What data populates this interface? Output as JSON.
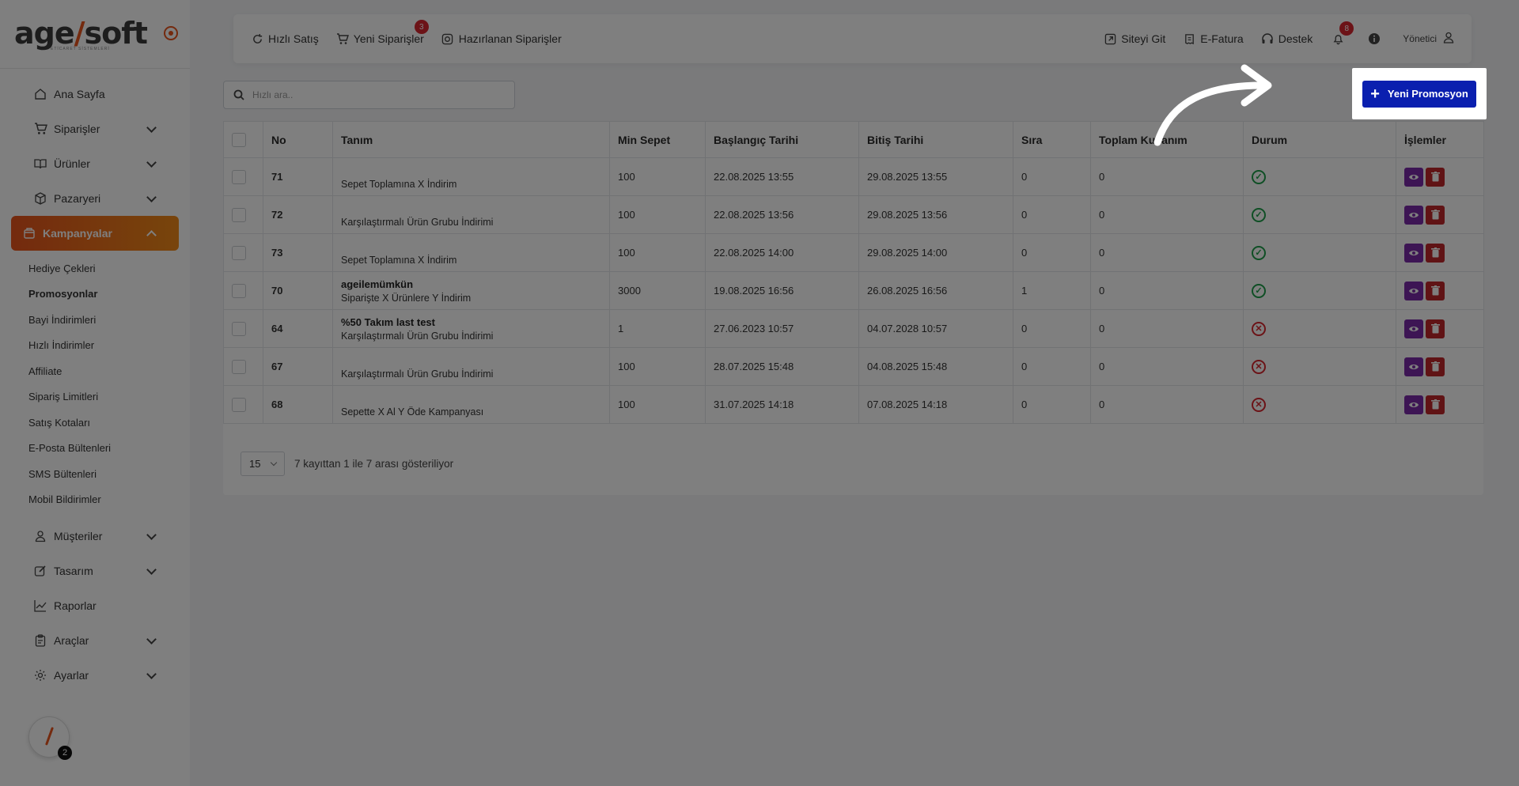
{
  "brand": {
    "logo_main": "age",
    "logo_slash": "/",
    "logo_rest": "soft",
    "logo_sub": "ETİCARET SİSTEMLERİ",
    "accent_color": "#e8541d"
  },
  "sidebar": {
    "items": [
      {
        "label": "Ana Sayfa",
        "icon": "home-icon",
        "has_chevron": false
      },
      {
        "label": "Siparişler",
        "icon": "cart-icon",
        "has_chevron": true
      },
      {
        "label": "Ürünler",
        "icon": "book-icon",
        "has_chevron": true
      },
      {
        "label": "Pazaryeri",
        "icon": "box-icon",
        "has_chevron": true
      },
      {
        "label": "Kampanyalar",
        "icon": "basket-icon",
        "has_chevron": true,
        "active": true
      }
    ],
    "subitems": [
      "Hediye Çekleri",
      "Promosyonlar",
      "Bayi İndirimleri",
      "Hızlı İndirimler",
      "Affiliate",
      "Sipariş Limitleri",
      "Satış Kotaları",
      "E-Posta Bültenleri",
      "SMS Bültenleri",
      "Mobil Bildirimler"
    ],
    "current_sub": "Promosyonlar",
    "bottom_items": [
      {
        "label": "Müşteriler",
        "icon": "user-icon",
        "has_chevron": true
      },
      {
        "label": "Tasarım",
        "icon": "edit-icon",
        "has_chevron": true
      },
      {
        "label": "Raporlar",
        "icon": "chart-icon",
        "has_chevron": false
      },
      {
        "label": "Araçlar",
        "icon": "clipboard-icon",
        "has_chevron": true
      },
      {
        "label": "Ayarlar",
        "icon": "gear-icon",
        "has_chevron": true
      }
    ],
    "helper_count": "2"
  },
  "topbar": {
    "quick_sale": "Hızlı Satış",
    "new_orders": "Yeni Siparişler",
    "new_orders_badge": "3",
    "prepared_orders": "Hazırlanan Siparişler",
    "visit_site": "Siteyi Git",
    "einvoice": "E-Fatura",
    "support": "Destek",
    "notif_badge": "8",
    "user": "Yönetici"
  },
  "search": {
    "placeholder": "Hızlı ara.."
  },
  "actions": {
    "new_promo": "Yeni Promosyon",
    "button_color": "#0a1faf"
  },
  "table": {
    "headers": [
      "No",
      "Tanım",
      "Min Sepet",
      "Başlangıç Tarihi",
      "Bitiş Tarihi",
      "Sıra",
      "Toplam Kullanım",
      "Durum",
      "İşlemler"
    ],
    "rows": [
      {
        "no": "71",
        "name": "",
        "type": "Sepet Toplamına X İndirim",
        "min": "100",
        "start": "22.08.2025 13:55",
        "end": "29.08.2025 13:55",
        "order": "0",
        "usage": "0",
        "status": "active"
      },
      {
        "no": "72",
        "name": "",
        "type": "Karşılaştırmalı Ürün Grubu İndirimi",
        "min": "100",
        "start": "22.08.2025 13:56",
        "end": "29.08.2025 13:56",
        "order": "0",
        "usage": "0",
        "status": "active"
      },
      {
        "no": "73",
        "name": "",
        "type": "Sepet Toplamına X İndirim",
        "min": "100",
        "start": "22.08.2025 14:00",
        "end": "29.08.2025 14:00",
        "order": "0",
        "usage": "0",
        "status": "active"
      },
      {
        "no": "70",
        "name": "ageilemümkün",
        "type": "Siparişte X Ürünlere Y İndirim",
        "min": "3000",
        "start": "19.08.2025 16:56",
        "end": "26.08.2025 16:56",
        "order": "1",
        "usage": "0",
        "status": "active"
      },
      {
        "no": "64",
        "name": "%50 Takım last test",
        "type": "Karşılaştırmalı Ürün Grubu İndirimi",
        "min": "1",
        "start": "27.06.2023 10:57",
        "end": "04.07.2028 10:57",
        "order": "0",
        "usage": "0",
        "status": "inactive"
      },
      {
        "no": "67",
        "name": "",
        "type": "Karşılaştırmalı Ürün Grubu İndirimi",
        "min": "100",
        "start": "28.07.2025 15:48",
        "end": "04.08.2025 15:48",
        "order": "0",
        "usage": "0",
        "status": "inactive"
      },
      {
        "no": "68",
        "name": "",
        "type": "Sepette X Al Y Öde Kampanyası",
        "min": "100",
        "start": "31.07.2025 14:18",
        "end": "07.08.2025 14:18",
        "order": "0",
        "usage": "0",
        "status": "inactive"
      }
    ]
  },
  "pager": {
    "page_size": "15",
    "info": "7 kayıttan 1 ile 7 arası gösteriliyor"
  }
}
